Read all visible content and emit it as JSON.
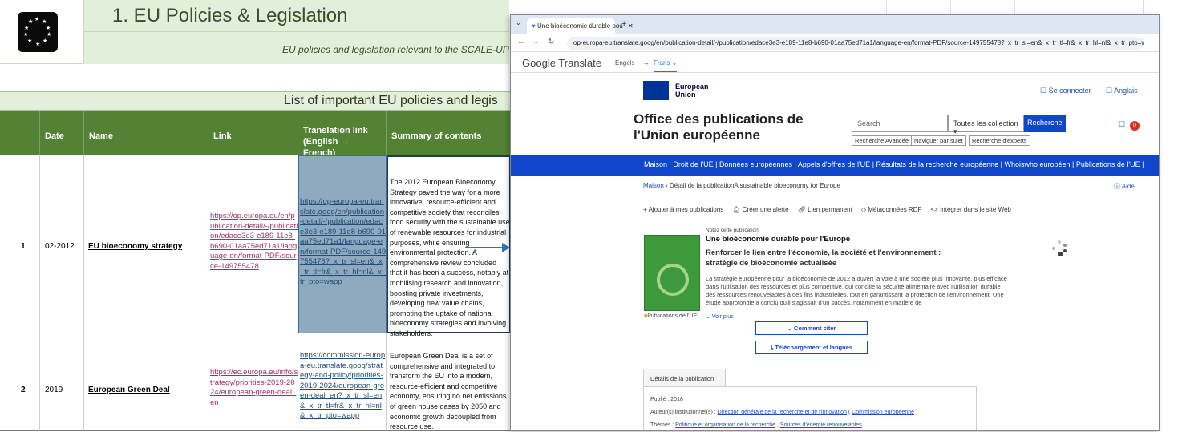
{
  "sheet": {
    "title": "1. EU Policies & Legislation",
    "subtitle": "EU policies and legislation relevant to the SCALE-UP pro",
    "list_title": "List of important EU policies and legis",
    "headers": [
      "Date",
      "Name",
      "Link",
      "Translation link (English → French)",
      "Summary of contents"
    ],
    "rows": [
      {
        "num": "1",
        "date": "02-2012",
        "name": "EU bioeconomy strategy",
        "link": "https://op.europa.eu/en/publication-detail/-/publication/edace3e3-e189-11e8-b690-01aa75ed71a1/language-en/format-PDF/source-149755478",
        "translation": "https://op-europa-eu.translate.goog/en/publication-detail/-/publication/edace3e3-e189-11e8-b690-01aa75ed71a1/language-en/format-PDF/source-149755478?_x_tr_sl=en&_x_tr_tl=fr&_x_tr_hl=nl&_x_tr_pto=wapp",
        "summary": "The 2012 European Bioeconomy Strategy paved the way for a more innovative, resource-efficient and competitive society that reconciles food security with the sustainable use of renewable resources for industrial purposes, while ensuring environmental protection. A comprehensive review concluded that it has been a success, notably at mobilising research and innovation, boosting private investments, developing new value chains, promoting the uptake of national bioeconomy strategies and involving stakeholders."
      },
      {
        "num": "2",
        "date": "2019",
        "name": "European Green Deal",
        "link": "https://ec.europa.eu/info/strategy/priorities-2019-2024/european-green-deal_en",
        "translation": "https://commission-europa-eu.translate.goog/strategy-and-policy/priorities-2019-2024/european-green-deal_en?_x_tr_sl=en&_x_tr_tl=fr&_x_tr_hl=nl&_x_tr_pto=wapp",
        "summary": "European Green Deal is a set of comprehensive and integrated to transform the EU into a modern, resource-efficient and competitive economy, ensuring no net emissions of green house gases by 2050 and economic growth decoupled from resource use."
      }
    ]
  },
  "browser": {
    "tab_title": "Une bioéconomie durable pou",
    "url": "op-europa-eu.translate.goog/en/publication-detail/-/publication/edace3e3-e189-11e8-b690-01aa75ed71a1/language-en/format-PDF/source-149755478?_x_tr_sl=en&_x_tr_tl=fr&_x_tr_hl=nl&_x_tr_pto=wapp",
    "translate_brand": "Google Translate",
    "lang_from": "Engels",
    "lang_to": "Frans",
    "eu_label_1": "European",
    "eu_label_2": "Union",
    "connect": "Se connecter",
    "language": "Anglais",
    "office_title": "Office des publications de l'Union européenne",
    "search_placeholder": "Search",
    "collection": "Toutes les collection",
    "search_btn": "Recherche",
    "adv_search": "Recherche Avancée",
    "nav_subject": "Naviguer par sujet",
    "expert_search": "Recherche d'experts",
    "badge": "0",
    "nav": [
      "Maison",
      "Droit de l'UE",
      "Données européennes",
      "Appels d'offres de l'UE",
      "Résultats de la recherche européenne",
      "Whoiswho européen",
      "Publications de l'UE"
    ],
    "crumb_home": "Maison",
    "crumb_detail": "Détail de la publication",
    "crumb_item": "A sustainable bioeconomy for Europe",
    "help": "Aide",
    "actions": [
      "Ajouter à mes publications",
      "Créer une alerte",
      "Lien permanent",
      "Métadonnées RDF",
      "Intégrer dans le site Web"
    ],
    "notez": "Notez cette publication",
    "pub_title": "Une bioéconomie durable pour l'Europe",
    "pub_subtitle": "Renforcer le lien entre l'économie, la société et l'environnement : stratégie de bioéconomie actualisée",
    "pub_desc": "La stratégie européenne pour la bioéconomie de 2012 a ouvert la voie à une société plus innovante, plus efficace dans l'utilisation des ressources et plus compétitive, qui concilie la sécurité alimentaire avec l'utilisation durable des ressources renouvelables à des fins industrielles, tout en garantissant la protection de l'environnement. Une étude approfondie a conclu qu'il s'agissait d'un succès, notamment en matière de",
    "pub_ue": "Publications de l'UE",
    "voir_plus": "Voir plus",
    "cite": "Comment citer",
    "download": "Téléchargement et langues",
    "details_tab": "Détails de la publication",
    "published": "Publié : 2018",
    "authors_label": "Auteur(s) institutionnel(s) :",
    "authors_link1": "Direction générale de la recherche et de l'innovation",
    "authors_link2": "Commission européenne",
    "themes_label": "Thèmes :",
    "themes_link1": "Politique et organisation de la recherche",
    "themes_link2": "Sources d'énergie renouvelables"
  }
}
